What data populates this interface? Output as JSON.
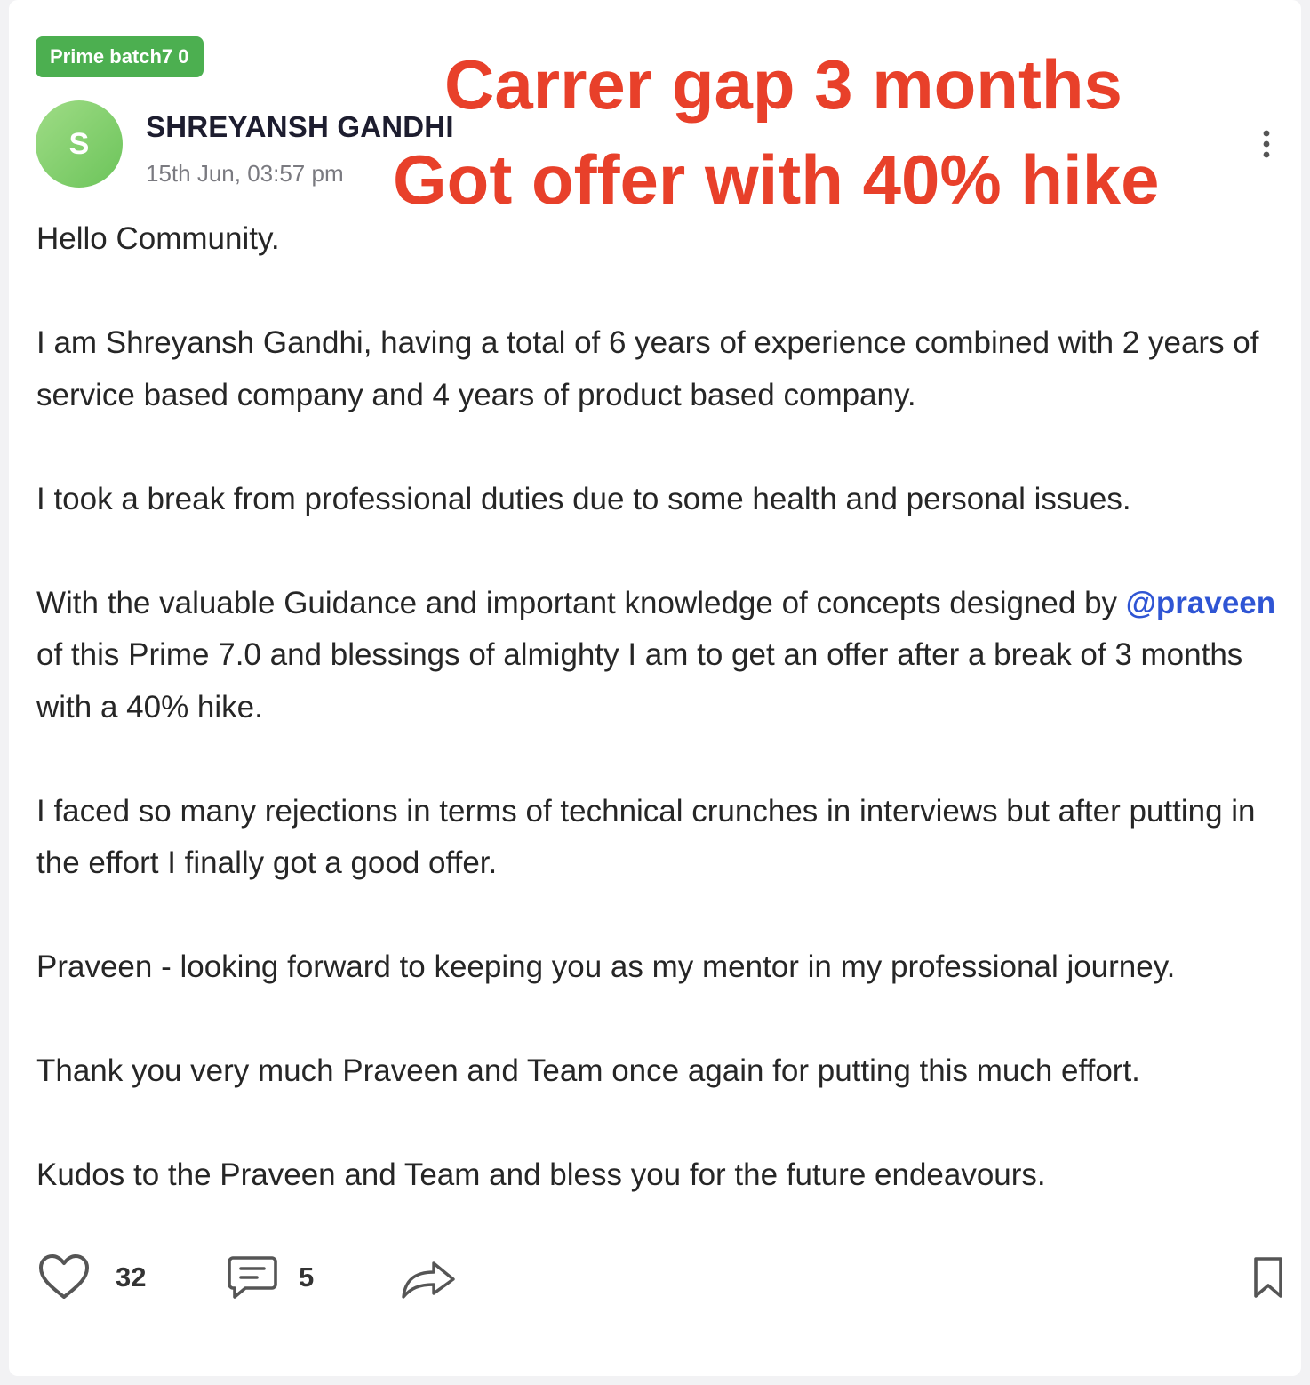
{
  "post": {
    "badge": "Prime batch7 0",
    "author": {
      "initial": "S",
      "name": "SHREYANSH GANDHI",
      "timestamp": "15th Jun, 03:57 pm"
    },
    "overlay": {
      "line1": "Carrer gap 3 months",
      "line2": "Got offer with 40% hike",
      "color": "#e8402a"
    },
    "body": {
      "p1": "Hello Community.",
      "p2": "I am Shreyansh Gandhi, having a total of 6 years of experience combined with 2 years of service based company and 4 years of product based company.",
      "p3": "I took a break from professional duties due to some health and personal issues.",
      "p4_before": "With the valuable Guidance and important knowledge of concepts designed by",
      "p4_mention": "@praveen",
      "p4_after": "of this Prime 7.0 and blessings of almighty I am to get an offer after a break of 3 months with a 40% hike.",
      "p5": "I faced so many rejections in terms of technical crunches in interviews but after putting in the effort I finally got a good offer.",
      "p6": "Praveen - looking forward to keeping you as my mentor in my professional journey.",
      "p7": "Thank you very much Praveen and Team once again for putting this much effort.",
      "p8": "Kudos to the Praveen and Team and bless you for the future endeavours."
    },
    "actions": {
      "likes": "32",
      "comments": "5",
      "like_icon": "heart-icon",
      "comment_icon": "comment-icon",
      "share_icon": "share-icon",
      "bookmark_icon": "bookmark-icon",
      "more_icon": "kebab-menu-icon"
    },
    "colors": {
      "badge": "#4caf50",
      "avatar": "#7fcd6a",
      "mention": "#2f55d4",
      "overlay_text": "#e8402a"
    }
  }
}
